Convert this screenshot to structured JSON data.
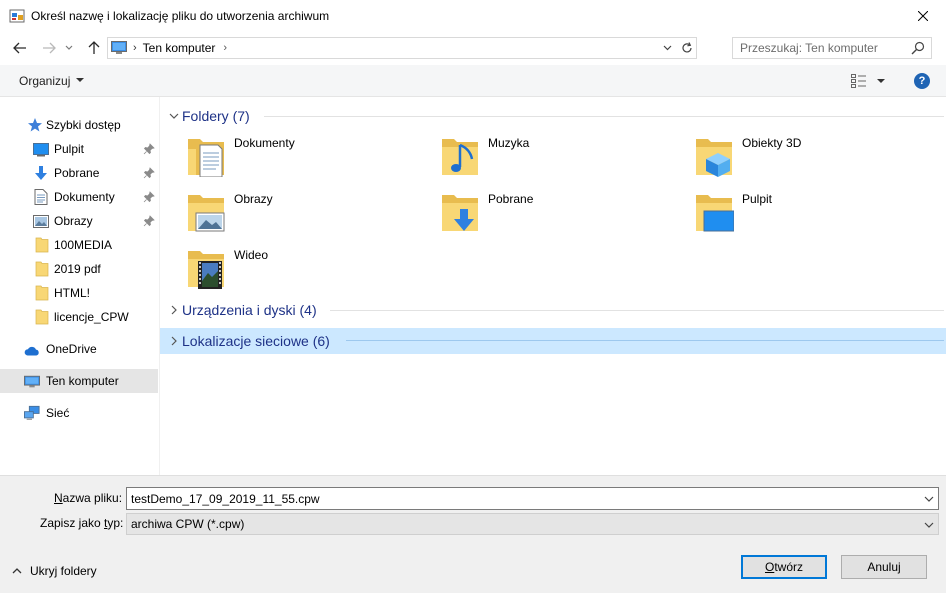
{
  "window": {
    "title": "Określ nazwę i lokalizację pliku do utworzenia archiwum"
  },
  "address": {
    "path": "Ten komputer",
    "search_placeholder": "Przeszukaj: Ten komputer"
  },
  "toolbar": {
    "organize_label": "Organizuj",
    "help_label": "?"
  },
  "nav": {
    "quick_access": "Szybki dostęp",
    "items": [
      {
        "label": "Pulpit",
        "icon": "desktop-icon",
        "pinned": true
      },
      {
        "label": "Pobrane",
        "icon": "download-icon",
        "pinned": true
      },
      {
        "label": "Dokumenty",
        "icon": "document-icon",
        "pinned": true
      },
      {
        "label": "Obrazy",
        "icon": "pictures-icon",
        "pinned": true
      },
      {
        "label": "100MEDIA",
        "icon": "folder-icon",
        "pinned": false
      },
      {
        "label": "2019 pdf",
        "icon": "folder-icon",
        "pinned": false
      },
      {
        "label": "HTML!",
        "icon": "folder-icon",
        "pinned": false
      },
      {
        "label": "licencje_CPW",
        "icon": "folder-icon",
        "pinned": false
      }
    ],
    "onedrive": "OneDrive",
    "this_pc": "Ten komputer",
    "network": "Sieć"
  },
  "content": {
    "groups": {
      "folders": "Foldery (7)",
      "devices": "Urządzenia i dyski (4)",
      "network": "Lokalizacje sieciowe (6)"
    },
    "folders": [
      {
        "label": "Dokumenty",
        "icon": "documents-folder-icon"
      },
      {
        "label": "Muzyka",
        "icon": "music-folder-icon"
      },
      {
        "label": "Obiekty 3D",
        "icon": "3d-objects-folder-icon"
      },
      {
        "label": "Obrazy",
        "icon": "pictures-folder-icon"
      },
      {
        "label": "Pobrane",
        "icon": "downloads-folder-icon"
      },
      {
        "label": "Pulpit",
        "icon": "desktop-folder-icon"
      },
      {
        "label": "Wideo",
        "icon": "videos-folder-icon"
      }
    ]
  },
  "form": {
    "filename_label_pre": "",
    "filename_label_u": "N",
    "filename_label_post": "azwa pliku:",
    "filename_value": "testDemo_17_09_2019_11_55.cpw",
    "filetype_label_pre": "Zapisz jako ",
    "filetype_label_u": "t",
    "filetype_label_post": "yp:",
    "filetype_value": "archiwa CPW (*.cpw)",
    "hide_folders": "Ukryj foldery",
    "open_u": "O",
    "open_rest": "twórz",
    "cancel": "Anuluj"
  },
  "colors": {
    "accent": "#0078d7",
    "group_header_text": "#1e3287",
    "highlight": "#cce8ff",
    "folder_yellow": "#f8d775"
  }
}
